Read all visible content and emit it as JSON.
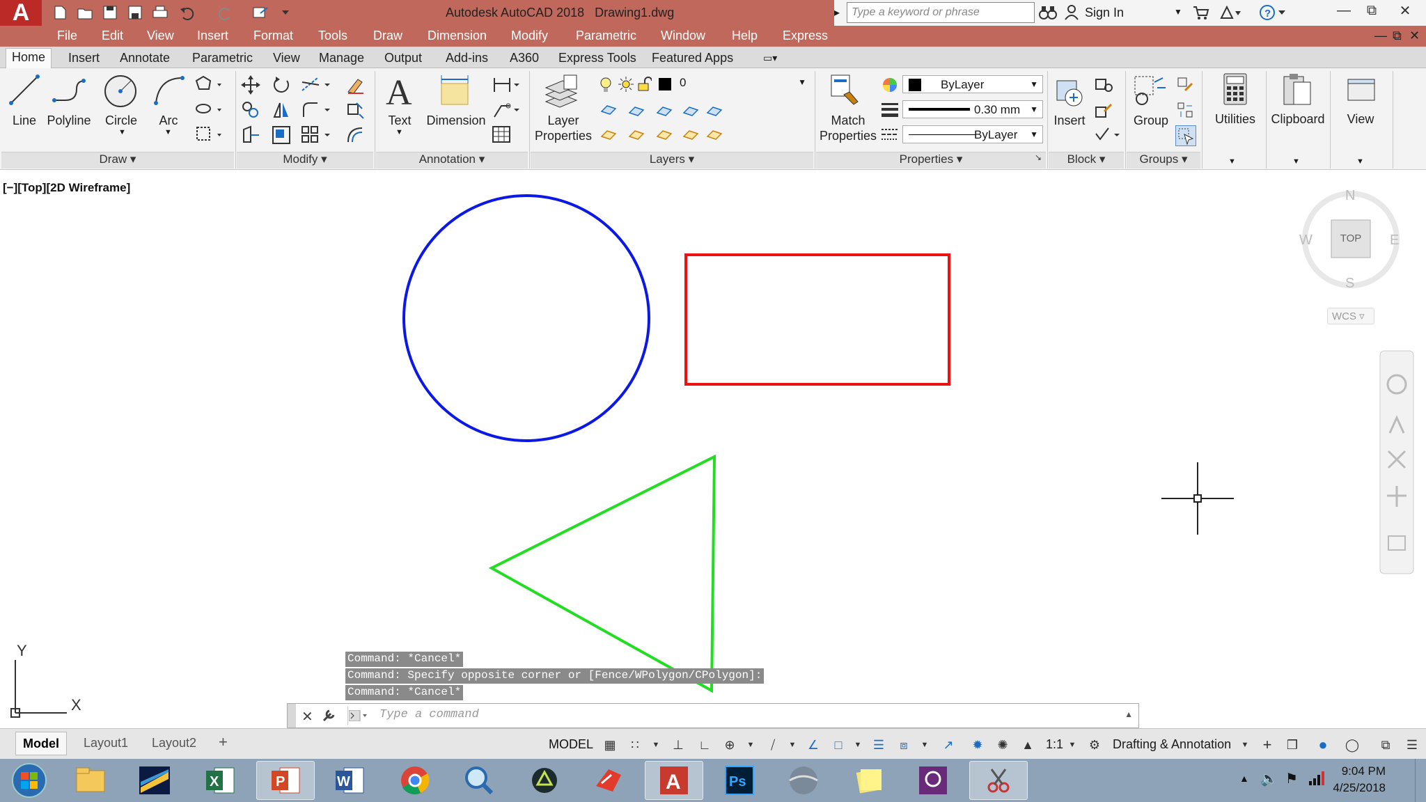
{
  "app": {
    "title": "Autodesk AutoCAD 2018",
    "file": "Drawing1.dwg",
    "logo": "A"
  },
  "search": {
    "placeholder": "Type a keyword or phrase"
  },
  "account": {
    "sign_in": "Sign In"
  },
  "menubar": [
    "File",
    "Edit",
    "View",
    "Insert",
    "Format",
    "Tools",
    "Draw",
    "Dimension",
    "Modify",
    "Parametric",
    "Window",
    "Help",
    "Express"
  ],
  "ribbon_tabs": [
    "Home",
    "Insert",
    "Annotate",
    "Parametric",
    "View",
    "Manage",
    "Output",
    "Add-ins",
    "A360",
    "Express Tools",
    "Featured Apps"
  ],
  "ribbon_active_tab": "Home",
  "draw_panel": {
    "line": "Line",
    "polyline": "Polyline",
    "circle": "Circle",
    "arc": "Arc",
    "title": "Draw"
  },
  "modify_panel": {
    "title": "Modify"
  },
  "annotation_panel": {
    "text": "Text",
    "dimension": "Dimension",
    "title": "Annotation"
  },
  "layers_panel": {
    "layer_props_1": "Layer",
    "layer_props_2": "Properties",
    "current_layer": "0",
    "title": "Layers"
  },
  "properties_panel": {
    "match_1": "Match",
    "match_2": "Properties",
    "color": "ByLayer",
    "lineweight": "0.30 mm",
    "linetype": "ByLayer",
    "title": "Properties"
  },
  "block_panel": {
    "insert": "Insert",
    "title": "Block"
  },
  "groups_panel": {
    "group": "Group",
    "title": "Groups"
  },
  "utilities": {
    "label": "Utilities"
  },
  "clipboard": {
    "label": "Clipboard"
  },
  "view": {
    "label": "View"
  },
  "viewport_label": "[−][Top][2D Wireframe]",
  "viewcube": {
    "north": "N",
    "south": "S",
    "east": "E",
    "west": "W",
    "face": "TOP",
    "wcs": "WCS"
  },
  "ucs": {
    "x": "X",
    "y": "Y"
  },
  "shapes": {
    "circle_color": "#0b18e6",
    "rect_color": "#ee1111",
    "triangle_color": "#22dd22"
  },
  "command_history": [
    "Command: *Cancel*",
    "Command: Specify opposite corner or [Fence/WPolygon/CPolygon]:",
    "Command: *Cancel*"
  ],
  "command_placeholder": "Type a command",
  "layouts": [
    "Model",
    "Layout1",
    "Layout2"
  ],
  "status": {
    "mode": "MODEL",
    "scale": "1:1",
    "workspace": "Drafting & Annotation"
  },
  "clock": {
    "time": "9:04 PM",
    "date": "4/25/2018"
  }
}
